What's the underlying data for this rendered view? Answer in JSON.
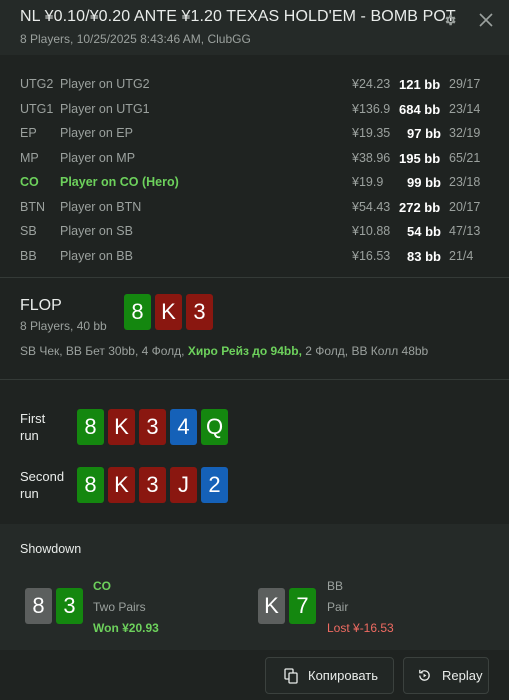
{
  "header": {
    "title": "NL ¥0.10/¥0.20 ANTE ¥1.20 TEXAS HOLD'EM - BOMB POT",
    "subtitle": "8 Players, 10/25/2025 8:43:46 AM, ClubGG"
  },
  "players": [
    {
      "pos": "UTG2",
      "name": "Player on UTG2",
      "money": "¥24.23",
      "bb": "121 bb",
      "stat": "29/17"
    },
    {
      "pos": "UTG1",
      "name": "Player on UTG1",
      "money": "¥136.9",
      "bb": "684 bb",
      "stat": "23/14"
    },
    {
      "pos": "EP",
      "name": "Player on EP",
      "money": "¥19.35",
      "bb": "97 bb",
      "stat": "32/19"
    },
    {
      "pos": "MP",
      "name": "Player on MP",
      "money": "¥38.96",
      "bb": "195 bb",
      "stat": "65/21"
    },
    {
      "pos": "CO",
      "name": "Player on CO (Hero)",
      "money": "¥19.9",
      "bb": "99 bb",
      "stat": "23/18"
    },
    {
      "pos": "BTN",
      "name": "Player on BTN",
      "money": "¥54.43",
      "bb": "272 bb",
      "stat": "20/17"
    },
    {
      "pos": "SB",
      "name": "Player on SB",
      "money": "¥10.88",
      "bb": "54 bb",
      "stat": "47/13"
    },
    {
      "pos": "BB",
      "name": "Player on BB",
      "money": "¥16.53",
      "bb": "83 bb",
      "stat": "21/4"
    }
  ],
  "flop": {
    "title": "FLOP",
    "subtitle": "8 Players, 40 bb",
    "cards": [
      "8",
      "K",
      "3"
    ],
    "actions_pre": "SB Чек, BB Бет 30bb, 4 Фолд, ",
    "actions_hero": "Хиро Рейз до 94bb,",
    "actions_post": " 2 Фолд, BB Колл 48bb"
  },
  "runs": {
    "first_label_1": "First",
    "first_label_2": "run",
    "first_cards": [
      "8",
      "K",
      "3",
      "4",
      "Q"
    ],
    "second_label_1": "Second",
    "second_label_2": "run",
    "second_cards": [
      "8",
      "K",
      "3",
      "J",
      "2"
    ]
  },
  "showdown": {
    "title": "Showdown",
    "hero": {
      "cards": [
        "8",
        "3"
      ],
      "pos": "CO",
      "hand": "Two Pairs",
      "result": "Won ¥20.93"
    },
    "villain": {
      "cards": [
        "K",
        "7"
      ],
      "pos": "BB",
      "hand": "Pair",
      "result": "Lost ¥-16.53"
    }
  },
  "footer": {
    "copy_label": "Копировать",
    "replay_label": "Replay"
  },
  "colors": {
    "hero_green": "#6dd15c",
    "lost_red": "#f06b62",
    "card_green": "#14870f",
    "card_red": "#8a1710",
    "card_blue": "#1561b8",
    "card_gray": "#5c5f5e"
  }
}
